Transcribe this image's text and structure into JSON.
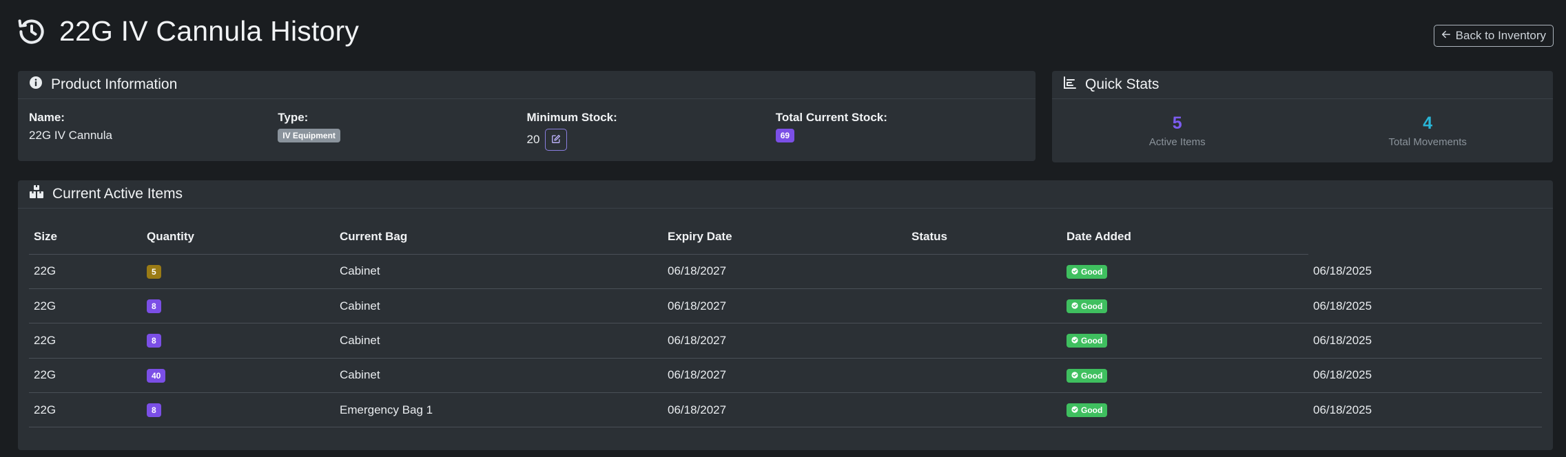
{
  "header": {
    "title": "22G IV Cannula History",
    "back_label": "Back to Inventory"
  },
  "product": {
    "section_title": "Product Information",
    "name_label": "Name:",
    "name_value": "22G IV Cannula",
    "type_label": "Type:",
    "type_value": "IV Equipment",
    "min_stock_label": "Minimum Stock:",
    "min_stock_value": "20",
    "total_stock_label": "Total Current Stock:",
    "total_stock_value": "69"
  },
  "stats": {
    "section_title": "Quick Stats",
    "active_items_value": "5",
    "active_items_label": "Active Items",
    "total_movements_value": "4",
    "total_movements_label": "Total Movements",
    "active_color": "#7c5cf0",
    "movements_color": "#29b5d6"
  },
  "active": {
    "section_title": "Current Active Items",
    "columns": [
      "Size",
      "Quantity",
      "Current Bag",
      "Expiry Date",
      "Status",
      "Date Added"
    ],
    "rows": [
      {
        "size": "22G",
        "quantity": "5",
        "qty_color": "yellow",
        "bag": "Cabinet",
        "expiry": "06/18/2027",
        "status": "Good",
        "added": "06/18/2025"
      },
      {
        "size": "22G",
        "quantity": "8",
        "qty_color": "purple",
        "bag": "Cabinet",
        "expiry": "06/18/2027",
        "status": "Good",
        "added": "06/18/2025"
      },
      {
        "size": "22G",
        "quantity": "8",
        "qty_color": "purple",
        "bag": "Cabinet",
        "expiry": "06/18/2027",
        "status": "Good",
        "added": "06/18/2025"
      },
      {
        "size": "22G",
        "quantity": "40",
        "qty_color": "purple",
        "bag": "Cabinet",
        "expiry": "06/18/2027",
        "status": "Good",
        "added": "06/18/2025"
      },
      {
        "size": "22G",
        "quantity": "8",
        "qty_color": "purple",
        "bag": "Emergency Bag 1",
        "expiry": "06/18/2027",
        "status": "Good",
        "added": "06/18/2025"
      }
    ]
  }
}
